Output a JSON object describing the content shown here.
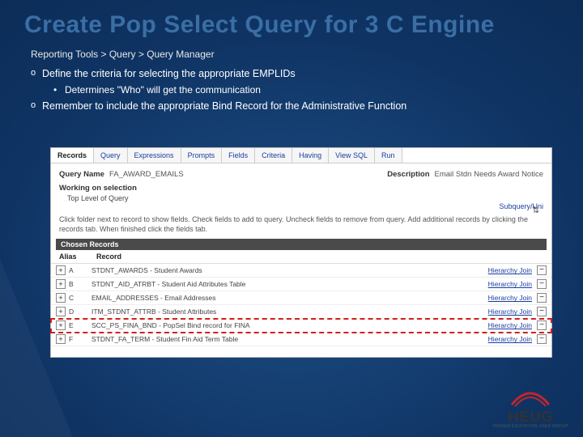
{
  "title": "Create Pop Select Query for 3 C Engine",
  "breadcrumb": "Reporting Tools > Query > Query Manager",
  "bullets": {
    "b0": "Define the criteria for selecting the appropriate EMPLIDs",
    "b0_sub0": "Determines \"Who\" will get the communication",
    "b1": "Remember to include the appropriate Bind Record for the Administrative Function"
  },
  "tabs": {
    "t0": "Records",
    "t1": "Query",
    "t2": "Expressions",
    "t3": "Prompts",
    "t4": "Fields",
    "t5": "Criteria",
    "t6": "Having",
    "t7": "View SQL",
    "t8": "Run"
  },
  "query": {
    "name_label": "Query Name",
    "name_value": "FA_AWARD_EMAILS",
    "desc_label": "Description",
    "desc_value": "Email Stdn Needs Award Notice",
    "working": "Working on selection",
    "toplevel": "Top Level of Query",
    "subquery": "Subquery/Uni",
    "instructions": "Click folder next to record to show fields. Check fields to add to query. Uncheck fields to remove from query. Add additional records by clicking the records tab. When finished click the fields tab.",
    "chosen": "Chosen Records",
    "head_alias": "Alias",
    "head_record": "Record",
    "hierarchy": "Hierarchy Join"
  },
  "records": [
    {
      "alias": "A",
      "name": "STDNT_AWARDS - Student Awards"
    },
    {
      "alias": "B",
      "name": "STDNT_AID_ATRBT - Student Aid Attributes Table"
    },
    {
      "alias": "C",
      "name": "EMAIL_ADDRESSES - Email Addresses"
    },
    {
      "alias": "D",
      "name": "ITM_STDNT_ATTRB - Student Attributes"
    },
    {
      "alias": "E",
      "name": "SCC_PS_FINA_BND - PopSel Bind record for FINA"
    },
    {
      "alias": "F",
      "name": "STDNT_FA_TERM - Student Fin Aid Term Table"
    }
  ],
  "logo": {
    "text": "HEUG",
    "sub": "HIGHER EDUCATION USER GROUP"
  }
}
